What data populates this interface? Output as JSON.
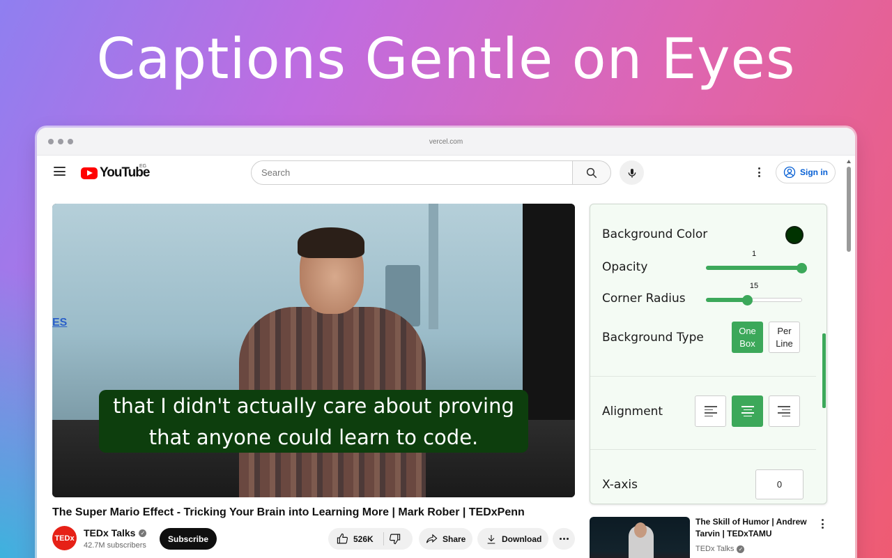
{
  "hero": {
    "title": "Captions Gentle on Eyes"
  },
  "browser": {
    "url": "vercel.com"
  },
  "header": {
    "logo_text": "YouTube",
    "country_code": "EG",
    "search_placeholder": "Search",
    "signin_label": "Sign in"
  },
  "video": {
    "caption_line1": "that I didn't actually care about proving",
    "caption_line2": "that anyone could learn to code.",
    "slide_text": "ES",
    "title": "The Super Mario Effect - Tricking Your Brain into Learning More | Mark Rober | TEDxPenn",
    "channel_name": "TEDx Talks",
    "channel_avatar_text": "TEDx",
    "subscribers": "42.7M subscribers",
    "subscribe_label": "Subscribe",
    "likes": "526K",
    "share_label": "Share",
    "download_label": "Download"
  },
  "panel": {
    "background_color_label": "Background Color",
    "background_color_value": "#003300",
    "opacity_label": "Opacity",
    "opacity_value": "1",
    "opacity_fraction": 1.0,
    "corner_radius_label": "Corner Radius",
    "corner_radius_value": "15",
    "corner_radius_fraction": 0.43,
    "background_type_label": "Background Type",
    "type_one_box": "One Box",
    "type_per_line": "Per Line",
    "alignment_label": "Alignment",
    "alignment_selected": "center",
    "xaxis_label": "X-axis",
    "xaxis_value": "0",
    "accent_color": "#3ca85a"
  },
  "recommendation": {
    "title": "The Skill of Humor | Andrew Tarvin | TEDxTAMU",
    "channel": "TEDx Talks"
  }
}
